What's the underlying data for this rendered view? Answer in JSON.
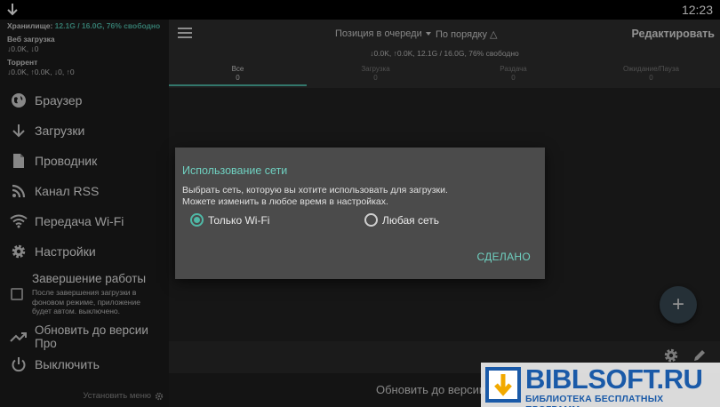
{
  "status_bar": {
    "time": "12:23"
  },
  "sidebar": {
    "storage_label": "Хранилище: ",
    "storage_value": "12.1G / 16.0G, 76% свободно",
    "web_label": "Веб загрузка",
    "web_speed": "↓0.0K, ↓0",
    "torrent_label": "Торрент",
    "torrent_speed": "↓0.0K, ↑0.0K, ↓0, ↑0",
    "items": [
      {
        "label": "Браузер",
        "icon": "globe-icon"
      },
      {
        "label": "Загрузки",
        "icon": "download-arrow-icon"
      },
      {
        "label": "Проводник",
        "icon": "file-icon"
      },
      {
        "label": "Канал RSS",
        "icon": "rss-icon"
      },
      {
        "label": "Передача Wi-Fi",
        "icon": "wifi-icon"
      },
      {
        "label": "Настройки",
        "icon": "gear-icon"
      }
    ],
    "finish": {
      "title": "Завершение работы",
      "desc": "После завершения загрузки в фоновом режиме, приложение будет автом. выключено."
    },
    "upgrade_label": "Обновить до версии Про",
    "poweroff_label": "Выключить",
    "install_menu": "Установить меню"
  },
  "toolbar": {
    "sort_position": "Позиция в очереди",
    "sort_order": "По порядку △",
    "edit_label": "Редактировать",
    "speed_info": "↓0.0K, ↑0.0K, 12.1G / 16.0G, 76% свободно"
  },
  "tabs": [
    {
      "label": "Все",
      "count": "0"
    },
    {
      "label": "Загрузка",
      "count": "0"
    },
    {
      "label": "Раздача",
      "count": "0"
    },
    {
      "label": "Ожидание/Пауза",
      "count": "0"
    }
  ],
  "fab": {
    "label": "+"
  },
  "upgrade_bar": {
    "label": "Обновить до версии Про"
  },
  "dialog": {
    "title": "Использование сети",
    "message_line1": "Выбрать сеть, которую вы хотите использовать для загрузки.",
    "message_line2": "Можете изменить в любое время в настройках.",
    "option_wifi": "Только Wi-Fi",
    "option_any": "Любая сеть",
    "selected": "wifi",
    "done_label": "СДЕЛАНО"
  },
  "watermark": {
    "brand": "BIBLSOFT.RU",
    "tagline": "БИБЛИОТЕКА БЕСПЛАТНЫХ ПРОГРАММ"
  },
  "colors": {
    "accent": "#4fb8a6",
    "dialog_title": "#6fd0c0",
    "sidebar_bg": "#1d1d1d",
    "dialog_bg": "#4b4b4b",
    "watermark_blue": "#1a5aa8"
  }
}
